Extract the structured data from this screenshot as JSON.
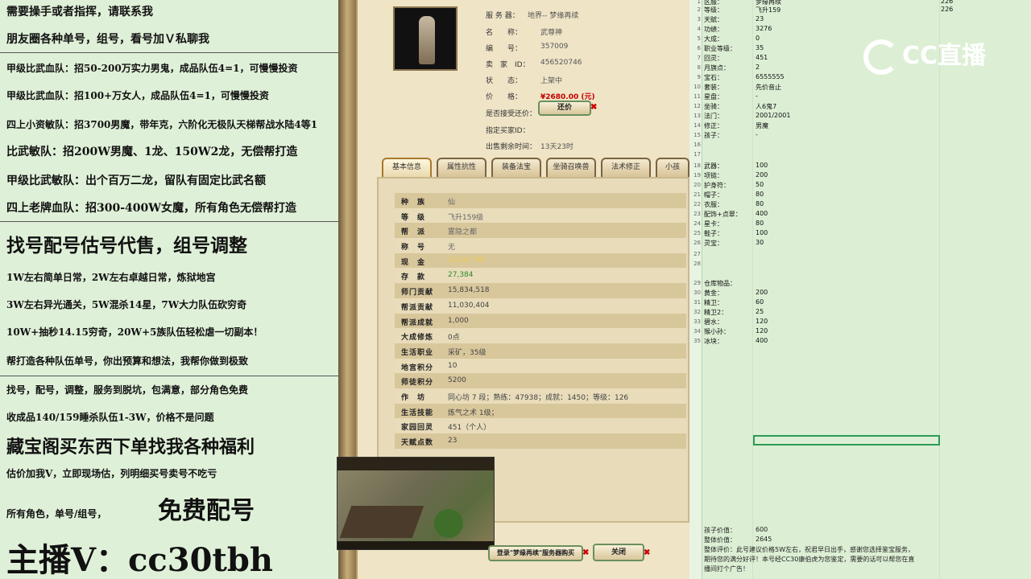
{
  "left_panel": {
    "lines": [
      "需要操手或者指挥，请联系我",
      "朋友圈各种单号，组号，看号加Ｖ私聊我",
      "甲级比武血队：招50-200万实力男鬼，成品队伍4=1，可慢慢投资",
      "甲级比武血队：招100+万女人，成品队伍4=1，可慢慢投资",
      "四上小资敏队：招3700男魔，带年克，六阶化无极队天梯帮战水陆4等1",
      "比武敏队：招200W男魔、1龙、150W2龙，无偿帮打造",
      "甲级比武敏队：出个百万二龙，留队有固定比武名额",
      "四上老牌血队：招300-400W女魔，所有角色无偿帮打造",
      "找号配号估号代售，组号调整",
      "1W左右简单日常，2W左右卓越日常，炼狱地宫",
      "3W左右异光通关，5W混杀14星，7W大力队伍砍穷奇",
      "10W+抽秒14.15穷奇，20W+5族队伍轻松虐一切副本！",
      "帮打造各种队伍单号，你出预算和想法，我帮你做到极致",
      "找号，配号，调整，服务到脱坑，包满意，部分角色免费",
      "收成品140/159睡杀队伍1-3W，价格不是问题",
      "藏宝阁买东西下单找我各种福利",
      "估价加我V，立即现场估，列明细买号卖号不吃亏",
      "所有角色，单号/组号，",
      "免费配号",
      "主播V：cc30tbh"
    ]
  },
  "game": {
    "info": [
      {
        "k": "服 务 器：",
        "v": "地界-- 梦缘再续"
      },
      {
        "k": "名　　称：",
        "v": "武尊神"
      },
      {
        "k": "编　　号：",
        "v": "357009"
      },
      {
        "k": "卖　家　ID：",
        "v": "456520746"
      },
      {
        "k": "状　　态：",
        "v": "上架中"
      },
      {
        "k": "价　　格：",
        "v": "¥2680.00 (元)"
      },
      {
        "k": "是否接受还价：",
        "v": ""
      },
      {
        "k": "指定买家ID：",
        "v": ""
      },
      {
        "k": "出售剩余时间：",
        "v": "13天23时"
      }
    ],
    "counter_button": "还价",
    "tabs": [
      "基本信息",
      "属性抗性",
      "装备法宝",
      "坐骑召唤兽",
      "法术修正",
      "小孩"
    ],
    "stats": [
      {
        "k": "种　族",
        "v": "仙"
      },
      {
        "k": "等　级",
        "v": "飞升159级"
      },
      {
        "k": "帮　派",
        "v": "雾隐之都"
      },
      {
        "k": "称　号",
        "v": "无"
      },
      {
        "k": "现　金",
        "v": "3,416,796"
      },
      {
        "k": "存　款",
        "v": "27,384"
      },
      {
        "k": "师门贡献",
        "v": "15,834,518"
      },
      {
        "k": "帮派贡献",
        "v": "11,030,404"
      },
      {
        "k": "帮派成就",
        "v": "1,000"
      },
      {
        "k": "大成修炼",
        "v": "0点"
      },
      {
        "k": "生活职业",
        "v": "采矿，35级"
      },
      {
        "k": "地宫积分",
        "v": "10"
      },
      {
        "k": "师徒积分",
        "v": "5200"
      },
      {
        "k": "作　坊",
        "v": "同心坊 7 段；熟练：47938；成就：1450；等级：126"
      },
      {
        "k": "生活技能",
        "v": "炼气之术 1级；"
      },
      {
        "k": "家园回灵",
        "v": "451（个人）"
      },
      {
        "k": "天赋点数",
        "v": "23"
      }
    ],
    "bottom_buttons": {
      "login": "登录\"梦缘再续\"服务器购买",
      "close": "关闭"
    }
  },
  "sheet": {
    "rows": [
      {
        "n": "1",
        "a": "区服：",
        "b": "梦缘再续",
        "c": "226"
      },
      {
        "n": "2",
        "a": "等级：",
        "b": "飞升159",
        "c": "226"
      },
      {
        "n": "3",
        "a": "天赋：",
        "b": "23",
        "c": ""
      },
      {
        "n": "4",
        "a": "功绩：",
        "b": "3276",
        "c": ""
      },
      {
        "n": "5",
        "a": "大成：",
        "b": "0",
        "c": ""
      },
      {
        "n": "6",
        "a": "职业等级：",
        "b": "35",
        "c": ""
      },
      {
        "n": "7",
        "a": "回灵：",
        "b": "451",
        "c": ""
      },
      {
        "n": "8",
        "a": "月旗点：",
        "b": "2",
        "c": ""
      },
      {
        "n": "9",
        "a": "宝石：",
        "b": "6555555",
        "c": ""
      },
      {
        "n": "10",
        "a": "套装：",
        "b": "先价音止",
        "c": ""
      },
      {
        "n": "11",
        "a": "星盘：",
        "b": "-",
        "c": ""
      },
      {
        "n": "12",
        "a": "坐骑：",
        "b": "人6鬼7",
        "c": ""
      },
      {
        "n": "13",
        "a": "法门：",
        "b": "2001/2001",
        "c": ""
      },
      {
        "n": "14",
        "a": "修正：",
        "b": "男魔",
        "c": ""
      },
      {
        "n": "15",
        "a": "孩子：",
        "b": "-",
        "c": ""
      },
      {
        "n": "16",
        "a": "",
        "b": "",
        "c": ""
      },
      {
        "n": "17",
        "a": "",
        "b": "",
        "c": ""
      },
      {
        "n": "18",
        "a": "武器：",
        "b": "100",
        "c": ""
      },
      {
        "n": "19",
        "a": "项链：",
        "b": "200",
        "c": ""
      },
      {
        "n": "20",
        "a": "护身符：",
        "b": "50",
        "c": ""
      },
      {
        "n": "21",
        "a": "帽子：",
        "b": "80",
        "c": ""
      },
      {
        "n": "22",
        "a": "衣服：",
        "b": "80",
        "c": ""
      },
      {
        "n": "23",
        "a": "配饰+点翠：",
        "b": "400",
        "c": ""
      },
      {
        "n": "24",
        "a": "星卡：",
        "b": "80",
        "c": ""
      },
      {
        "n": "25",
        "a": "鞋子：",
        "b": "100",
        "c": ""
      },
      {
        "n": "26",
        "a": "灵宝：",
        "b": "30",
        "c": ""
      },
      {
        "n": "27",
        "a": "",
        "b": "",
        "c": ""
      },
      {
        "n": "28",
        "a": "",
        "b": "",
        "c": ""
      },
      {
        "n": "29",
        "a": "仓库物品：",
        "b": "",
        "c": ""
      },
      {
        "n": "30",
        "a": "黄金：",
        "b": "200",
        "c": ""
      },
      {
        "n": "31",
        "a": "精卫：",
        "b": "60",
        "c": ""
      },
      {
        "n": "32",
        "a": "精卫2：",
        "b": "25",
        "c": ""
      },
      {
        "n": "33",
        "a": "碧水：",
        "b": "120",
        "c": ""
      },
      {
        "n": "34",
        "a": "猴小孙：",
        "b": "120",
        "c": ""
      },
      {
        "n": "35",
        "a": "冰块：",
        "b": "400",
        "c": ""
      }
    ],
    "footer": {
      "child_value_label": "孩子价值：",
      "child_value": "600",
      "total_value_label": "整体价值：",
      "total_value": "2645",
      "comment_1": "整体评价：此号建议价格5W左右，祝君早日出手，感谢您选择鉴宝服务，",
      "comment_2": "期待您的满分好评！本号经CC30康伯虎为您鉴定，需要的话可以帮您在直",
      "comment_3": "播间打个广告！"
    }
  },
  "logo": "CC直播"
}
